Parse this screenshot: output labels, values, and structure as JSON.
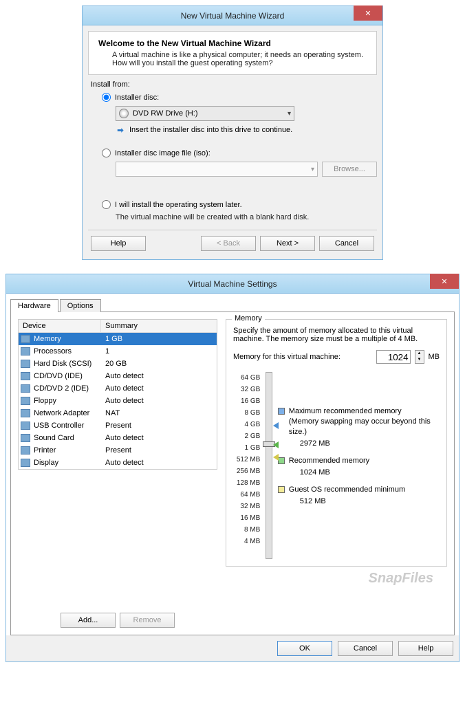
{
  "wizard": {
    "title": "New Virtual Machine Wizard",
    "welcome_title": "Welcome to the New Virtual Machine Wizard",
    "welcome_sub": "A virtual machine is like a physical computer; it needs an operating system. How will you install the guest operating system?",
    "install_from": "Install from:",
    "radio_disc": "Installer disc:",
    "disc_value": "DVD RW Drive (H:)",
    "hint": "Insert the installer disc into this drive to continue.",
    "radio_iso": "Installer disc image file (iso):",
    "browse": "Browse...",
    "radio_later": "I will install the operating system later.",
    "later_note": "The virtual machine will be created with a blank hard disk.",
    "help": "Help",
    "back": "< Back",
    "next": "Next >",
    "cancel": "Cancel"
  },
  "settings": {
    "title": "Virtual Machine Settings",
    "tab_hardware": "Hardware",
    "tab_options": "Options",
    "col_device": "Device",
    "col_summary": "Summary",
    "devices": [
      {
        "name": "Memory",
        "summary": "1 GB"
      },
      {
        "name": "Processors",
        "summary": "1"
      },
      {
        "name": "Hard Disk (SCSI)",
        "summary": "20 GB"
      },
      {
        "name": "CD/DVD (IDE)",
        "summary": "Auto detect"
      },
      {
        "name": "CD/DVD 2 (IDE)",
        "summary": "Auto detect"
      },
      {
        "name": "Floppy",
        "summary": "Auto detect"
      },
      {
        "name": "Network Adapter",
        "summary": "NAT"
      },
      {
        "name": "USB Controller",
        "summary": "Present"
      },
      {
        "name": "Sound Card",
        "summary": "Auto detect"
      },
      {
        "name": "Printer",
        "summary": "Present"
      },
      {
        "name": "Display",
        "summary": "Auto detect"
      }
    ],
    "add": "Add...",
    "remove": "Remove",
    "memory_legend": "Memory",
    "memory_desc": "Specify the amount of memory allocated to this virtual machine. The memory size must be a multiple of 4 MB.",
    "memory_label": "Memory for this virtual machine:",
    "memory_value": "1024",
    "memory_unit": "MB",
    "slider_ticks": [
      "64 GB",
      "32 GB",
      "16 GB",
      "8 GB",
      "4 GB",
      "2 GB",
      "1 GB",
      "512 MB",
      "256 MB",
      "128 MB",
      "64 MB",
      "32 MB",
      "16 MB",
      "8 MB",
      "4 MB"
    ],
    "max_rec": "Maximum recommended memory",
    "max_rec_note": "(Memory swapping may occur beyond this size.)",
    "max_rec_val": "2972 MB",
    "rec": "Recommended memory",
    "rec_val": "1024 MB",
    "min": "Guest OS recommended minimum",
    "min_val": "512 MB",
    "ok": "OK",
    "cancel": "Cancel",
    "help": "Help"
  },
  "watermark": "SnapFiles"
}
